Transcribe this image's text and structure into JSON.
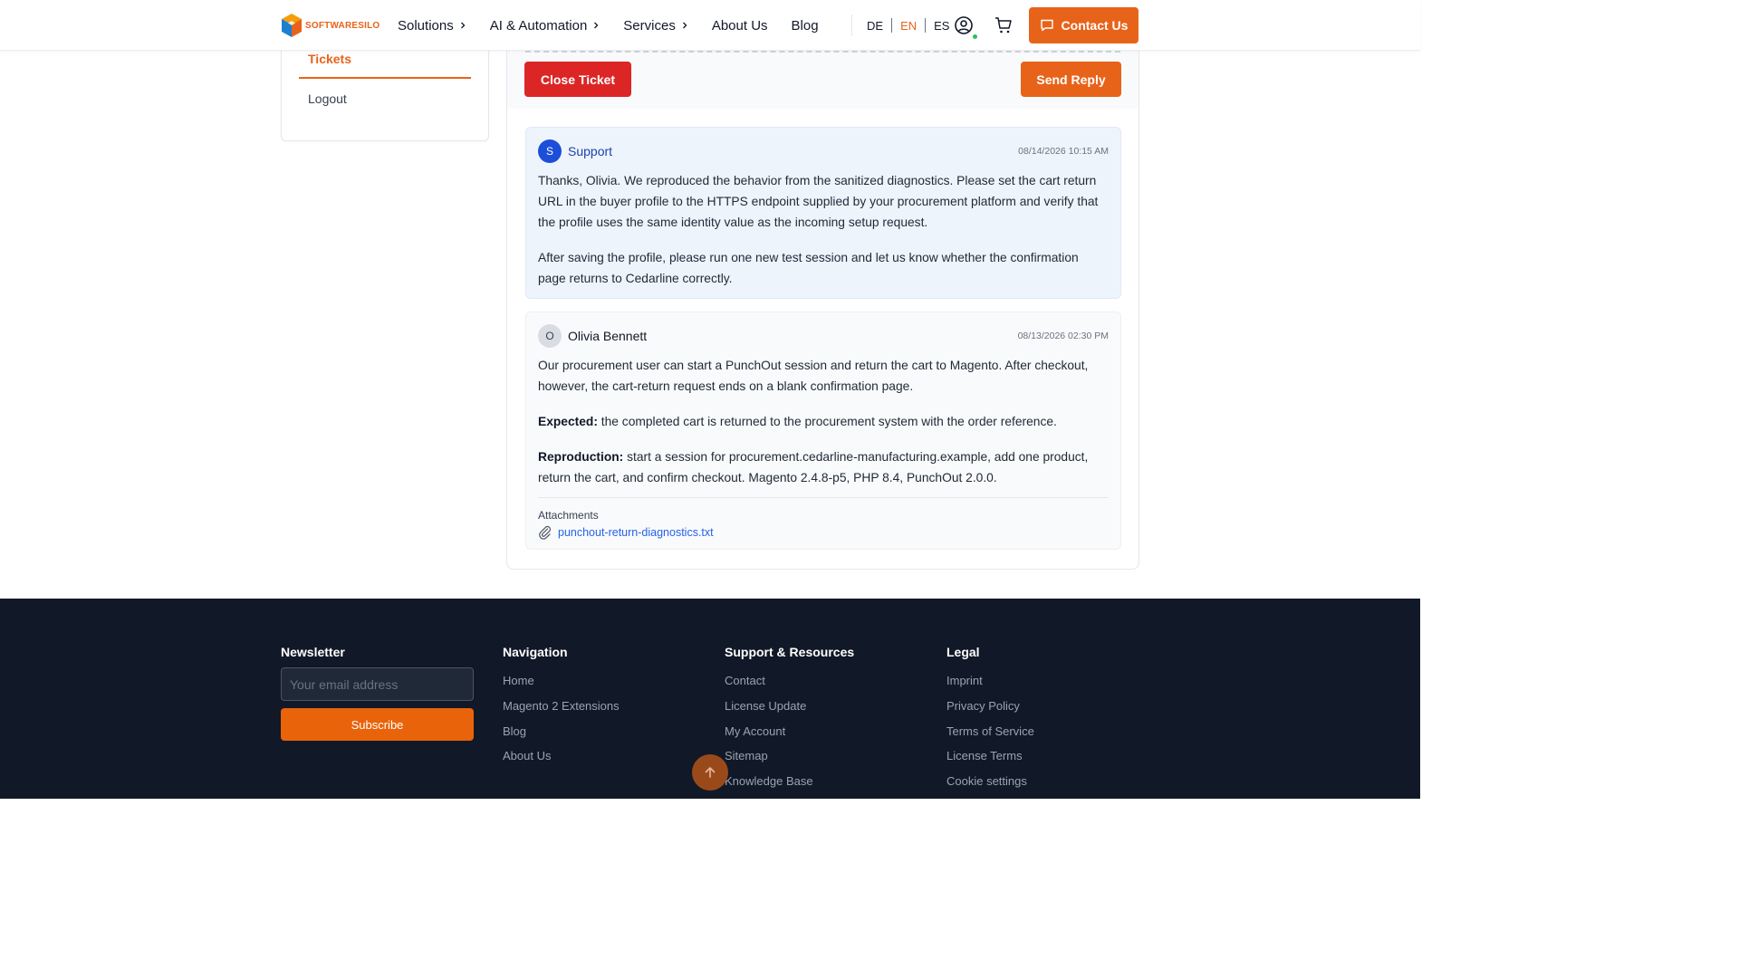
{
  "header": {
    "logo_text": "SOFTWARESILO",
    "nav": [
      "Solutions",
      "AI & Automation",
      "Services",
      "About Us",
      "Blog"
    ],
    "languages": [
      "DE",
      "EN",
      "ES"
    ],
    "active_language": "EN",
    "contact_label": "Contact Us"
  },
  "sidebar": {
    "tickets_label": "Tickets",
    "logout_label": "Logout"
  },
  "ticket": {
    "close_label": "Close Ticket",
    "send_label": "Send Reply",
    "messages": [
      {
        "avatar": "S",
        "author": "Support",
        "date": "08/14/2026 10:15 AM",
        "paragraphs": [
          "Thanks, Olivia. We reproduced the behavior from the sanitized diagnostics. Please set the cart return URL in the buyer profile to the HTTPS endpoint supplied by your procurement platform and verify that the profile uses the same identity value as the incoming setup request.",
          "After saving the profile, please run one new test session and let us know whether the confirmation page returns to Cedarline correctly."
        ]
      },
      {
        "avatar": "O",
        "author": "Olivia Bennett",
        "date": "08/13/2026 02:30 PM",
        "paragraph_1": "Our procurement user can start a PunchOut session and return the cart to Magento. After checkout, however, the cart-return request ends on a blank confirmation page.",
        "expected_label": "Expected:",
        "expected_text": " the completed cart is returned to the procurement system with the order reference.",
        "repro_label": "Reproduction:",
        "repro_text": " start a session for procurement.cedarline-manufacturing.example, add one product, return the cart, and confirm checkout. Magento 2.4.8-p5, PHP 8.4, PunchOut 2.0.0.",
        "attachments_label": "Attachments",
        "attachment": "punchout-return-diagnostics.txt"
      }
    ]
  },
  "footer": {
    "newsletter": {
      "title": "Newsletter",
      "placeholder": "Your email address",
      "subscribe_label": "Subscribe"
    },
    "navigation": {
      "title": "Navigation",
      "links": [
        "Home",
        "Magento 2 Extensions",
        "Blog",
        "About Us"
      ]
    },
    "support": {
      "title": "Support & Resources",
      "links": [
        "Contact",
        "License Update",
        "My Account",
        "Sitemap",
        "Knowledge Base"
      ]
    },
    "legal": {
      "title": "Legal",
      "links": [
        "Imprint",
        "Privacy Policy",
        "Terms of Service",
        "License Terms",
        "Cookie settings"
      ]
    }
  },
  "colors": {
    "accent": "#e8631a",
    "danger": "#dc2626",
    "footer_bg": "#111827",
    "link": "#2563eb"
  },
  "icons": {
    "account": "user-circle-icon",
    "cart": "shopping-cart-icon",
    "contact": "chat-bubble-icon",
    "attachment": "paperclip-icon",
    "scroll_top": "arrow-up-icon",
    "nav_chevron": "chevron-right-icon"
  }
}
